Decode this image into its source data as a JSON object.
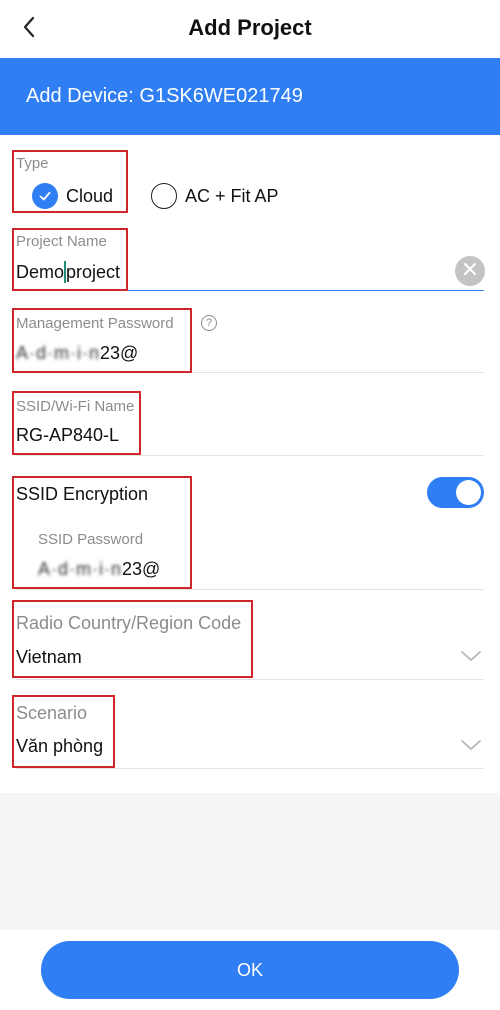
{
  "header": {
    "title": "Add Project",
    "back_icon": "chevron-left-icon"
  },
  "banner": {
    "text": "Add Device: G1SK6WE021749",
    "color": "#2f7ef3"
  },
  "form": {
    "type": {
      "label": "Type",
      "options": [
        {
          "label": "Cloud",
          "selected": true
        },
        {
          "label": "AC + Fit AP",
          "selected": false
        }
      ]
    },
    "project_name": {
      "label": "Project Name",
      "value_before_cursor": "Demo",
      "value_after_cursor": "project"
    },
    "management_password": {
      "label": "Management Password",
      "value_obscured": "A·d·m·i·n",
      "value_visible": "23@",
      "help_icon": "question-circle-icon"
    },
    "ssid": {
      "label": "SSID/Wi-Fi Name",
      "value": "RG-AP840-L"
    },
    "ssid_encryption": {
      "label": "SSID Encryption",
      "enabled": true,
      "password_label": "SSID Password",
      "password_obscured": "A·d·m·i·n",
      "password_visible": "23@"
    },
    "country": {
      "label": "Radio Country/Region Code",
      "value": "Vietnam"
    },
    "scenario": {
      "label": "Scenario",
      "value": "Văn phòng"
    }
  },
  "footer": {
    "ok_label": "OK"
  },
  "colors": {
    "accent": "#2f7ef3",
    "highlight_box": "#d0262b"
  }
}
